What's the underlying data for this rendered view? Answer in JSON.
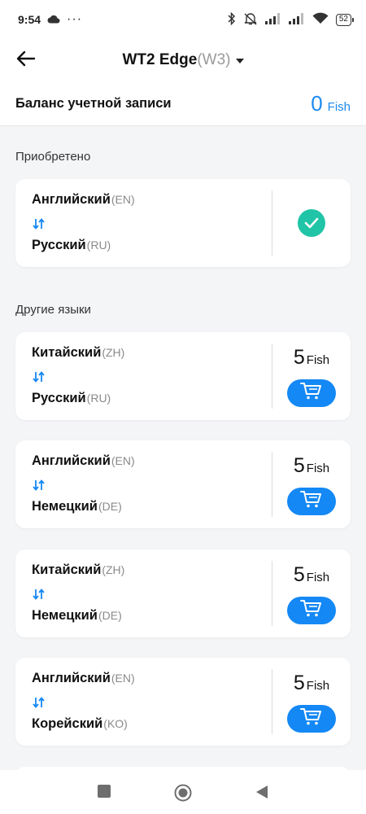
{
  "status_bar": {
    "time": "9:54",
    "dots": "···",
    "battery": "52"
  },
  "header": {
    "device_name": "WT2 Edge",
    "device_model": "(W3)"
  },
  "balance": {
    "label": "Баланс учетной записи",
    "amount": "0",
    "unit": "Fish"
  },
  "purchased": {
    "title": "Приобретено",
    "items": [
      {
        "from_name": "Английский",
        "from_code": "(EN)",
        "to_name": "Русский",
        "to_code": "(RU)"
      }
    ]
  },
  "other": {
    "title": "Другие языки",
    "items": [
      {
        "from_name": "Китайский",
        "from_code": "(ZH)",
        "to_name": "Русский",
        "to_code": "(RU)",
        "price": "5",
        "unit": "Fish"
      },
      {
        "from_name": "Английский",
        "from_code": "(EN)",
        "to_name": "Немецкий",
        "to_code": "(DE)",
        "price": "5",
        "unit": "Fish"
      },
      {
        "from_name": "Китайский",
        "from_code": "(ZH)",
        "to_name": "Немецкий",
        "to_code": "(DE)",
        "price": "5",
        "unit": "Fish"
      },
      {
        "from_name": "Английский",
        "from_code": "(EN)",
        "to_name": "Корейский",
        "to_code": "(KO)",
        "price": "5",
        "unit": "Fish"
      }
    ]
  },
  "colors": {
    "accent": "#1488f5",
    "check": "#20c4a6",
    "background": "#f4f5f7"
  },
  "icons": {
    "back": "arrow-left-icon",
    "cart": "cart-icon",
    "swap": "swap-arrows-icon",
    "check": "check-icon"
  }
}
